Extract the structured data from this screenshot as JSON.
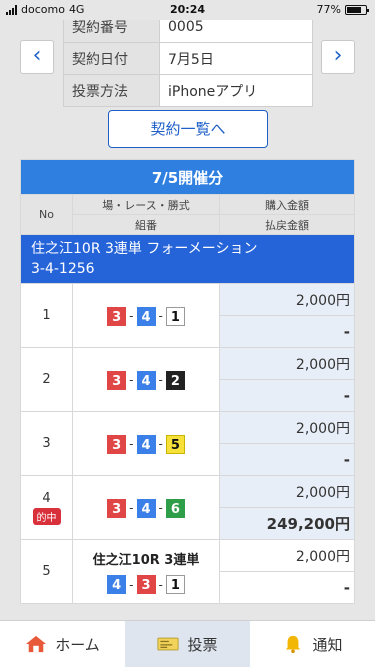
{
  "status": {
    "carrier": "docomo",
    "network": "4G",
    "time": "20:24",
    "battery": "77%",
    "battery_level": 0.77
  },
  "contract": {
    "rows": [
      {
        "label": "契約番号",
        "value": "0005"
      },
      {
        "label": "契約日付",
        "value": "7月5日"
      },
      {
        "label": "投票方法",
        "value": "iPhoneアプリ"
      }
    ],
    "list_button": "契約一覧へ"
  },
  "nav": {
    "prev": "‹",
    "next": "›"
  },
  "table": {
    "title": "7/5開催分",
    "col_no": "No",
    "col_place": "場・レース・勝式",
    "col_combo": "組番",
    "col_buy": "購入金額",
    "col_return": "払戻金額",
    "section": {
      "line1": "住之江10R 3連単 フォーメーション",
      "line2": "3-4-1256"
    },
    "rows": [
      {
        "no": "1",
        "hit": "",
        "amount": "2,000円",
        "return": "-",
        "combo": [
          "3",
          "4",
          "1"
        ]
      },
      {
        "no": "2",
        "hit": "",
        "amount": "2,000円",
        "return": "-",
        "combo": [
          "3",
          "4",
          "2"
        ]
      },
      {
        "no": "3",
        "hit": "",
        "amount": "2,000円",
        "return": "-",
        "combo": [
          "3",
          "4",
          "5"
        ]
      },
      {
        "no": "4",
        "hit": "的中",
        "amount": "2,000円",
        "return": "249,200円",
        "combo": [
          "3",
          "4",
          "6"
        ]
      }
    ],
    "row5": {
      "no": "5",
      "title": "住之江10R 3連単",
      "amount": "2,000円",
      "return": "-",
      "combo": [
        "4",
        "3",
        "1"
      ]
    }
  },
  "tabs": [
    {
      "label": "ホーム",
      "icon": "home-icon"
    },
    {
      "label": "投票",
      "icon": "ticket-icon"
    },
    {
      "label": "通知",
      "icon": "bell-icon"
    }
  ],
  "colors": {
    "accent": "#1e5fc8",
    "header_blue": "#2f7fe0",
    "section_blue": "#2563d9",
    "hit_red": "#d9313b"
  }
}
